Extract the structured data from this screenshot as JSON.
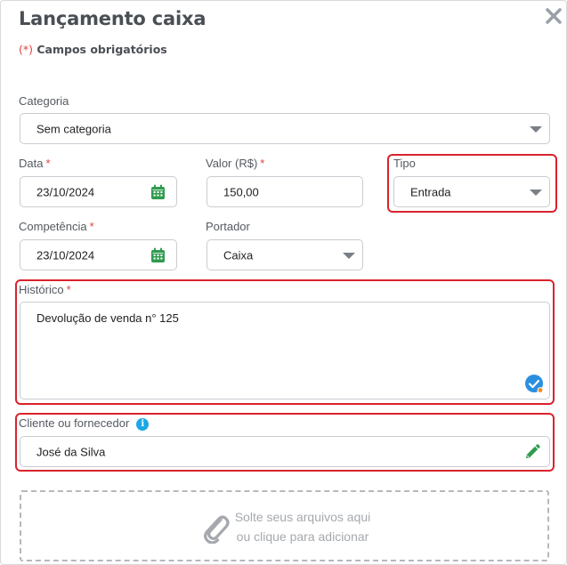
{
  "dialog": {
    "title": "Lançamento caixa",
    "required_mark": "(*)",
    "required_note": "Campos obrigatórios"
  },
  "categoria": {
    "label": "Categoria",
    "value": "Sem categoria"
  },
  "data": {
    "label": "Data",
    "required": "*",
    "value": "23/10/2024"
  },
  "valor": {
    "label": "Valor (R$)",
    "required": "*",
    "value": "150,00"
  },
  "tipo": {
    "label": "Tipo",
    "value": "Entrada"
  },
  "competencia": {
    "label": "Competência",
    "required": "*",
    "value": "23/10/2024"
  },
  "portador": {
    "label": "Portador",
    "value": "Caixa"
  },
  "historico": {
    "label": "Histórico",
    "required": "*",
    "value": "Devolução de venda n° 125"
  },
  "cliente": {
    "label": "Cliente ou fornecedor",
    "info_icon": "i",
    "value": "José da Silva"
  },
  "dropzone": {
    "line1": "Solte seus arquivos aqui",
    "line2": "ou clique para adicionar"
  },
  "colors": {
    "accent_red": "#d9232d",
    "required_red": "#e0423c",
    "calendar_green": "#2e9b4e",
    "check_blue": "#2b8fe0",
    "info_blue": "#1ca7e6"
  },
  "icons": {
    "close": "close-icon",
    "calendar": "calendar-icon",
    "check": "check-circle-icon",
    "info": "info-icon",
    "edit": "pencil-icon",
    "attach": "paperclip-icon"
  }
}
